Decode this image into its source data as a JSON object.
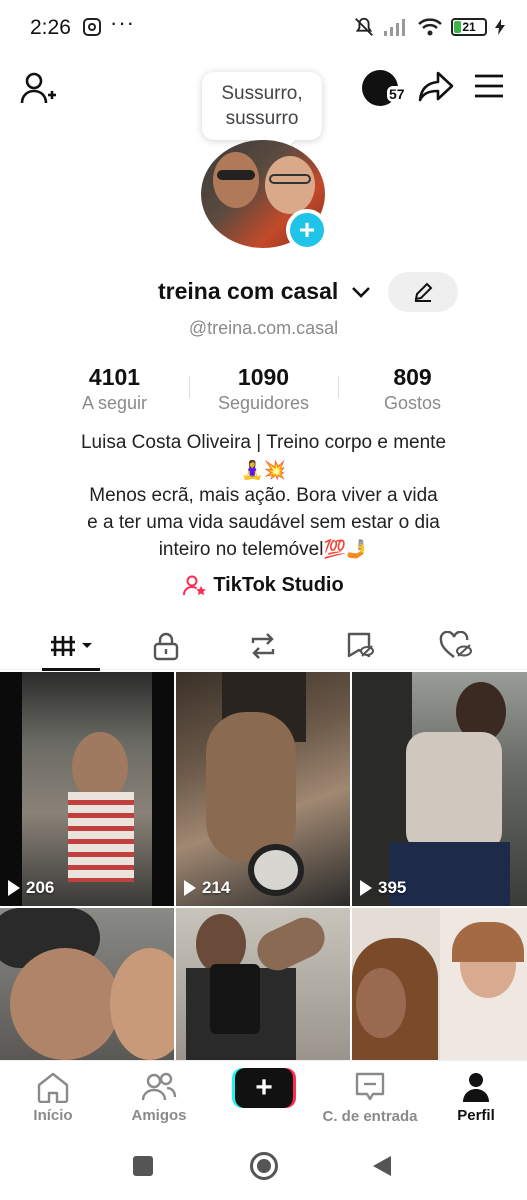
{
  "status_bar": {
    "time": "2:26",
    "more": "···",
    "battery": "21",
    "icons": [
      "instagram-icon",
      "mute-icon",
      "signal-icon",
      "wifi-icon",
      "battery-icon",
      "charging-icon"
    ]
  },
  "top_bar": {
    "tooltip_line1": "Sussurro,",
    "tooltip_line2": "sussurro",
    "coins_count": "57",
    "icons": [
      "add-friend-icon",
      "share-icon",
      "menu-icon"
    ]
  },
  "profile": {
    "name": "treina com casal",
    "handle": "@treina.com.casal",
    "stats": [
      {
        "value": "4101",
        "label": "A seguir"
      },
      {
        "value": "1090",
        "label": "Seguidores"
      },
      {
        "value": "809",
        "label": "Gostos"
      }
    ],
    "bio_line1": "Luisa Costa Oliveira | Treino corpo e mente",
    "bio_emoji1": "🧘‍♀️💥",
    "bio_line2": "Menos ecrã, mais ação. Bora viver a vida",
    "bio_line3": "e a ter uma vida saudável sem estar o dia",
    "bio_line4": "inteiro no telemóvel",
    "bio_emoji2": "💯🤳",
    "studio_label": "TikTok Studio"
  },
  "tabs": [
    "videos-grid",
    "private",
    "reposts",
    "favorites",
    "liked"
  ],
  "videos": [
    {
      "views": "206",
      "color": "#5a5a55"
    },
    {
      "views": "214",
      "color": "#4a4038"
    },
    {
      "views": "395",
      "color": "#6b6e6a"
    },
    {
      "views": "",
      "color": "#3a3836"
    },
    {
      "views": "",
      "color": "#4d4944"
    },
    {
      "views": "",
      "color": "#8a6a55"
    }
  ],
  "bottom_nav": {
    "home": "Início",
    "friends": "Amigos",
    "create": "+",
    "inbox": "C. de entrada",
    "profile": "Perfil"
  },
  "colors": {
    "accent_cyan": "#25f4ee",
    "accent_red": "#fe2c55",
    "avatar_add": "#20c4e8"
  }
}
